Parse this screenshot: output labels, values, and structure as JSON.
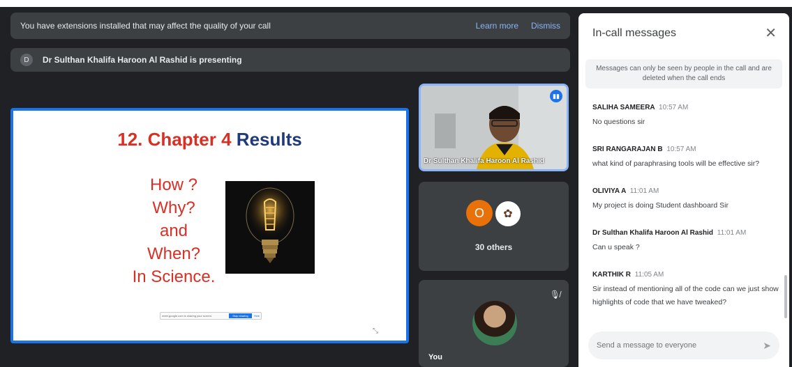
{
  "banner": {
    "message": "You have extensions installed that may affect the quality of your call",
    "learn_more": "Learn more",
    "dismiss": "Dismiss"
  },
  "presenting": {
    "initial": "D",
    "text": "Dr Sulthan Khalifa Haroon Al Rashid is presenting"
  },
  "slide": {
    "title_part1": "12. Chapter 4",
    "title_part2": "Results",
    "questions": [
      "How ?",
      "Why?",
      "and",
      "When?",
      "In Science."
    ],
    "bar_text": "meet.google.com is sharing your screen.",
    "bar_button": "Stop sharing",
    "bar_hide": "Hide"
  },
  "tiles": {
    "presenter_name": "Dr Sulthan Khalifa Haroon Al Rashid",
    "others_initial": "O",
    "others_label": "30 others",
    "you_label": "You"
  },
  "chat": {
    "title": "In-call messages",
    "note": "Messages can only be seen by people in the call and are deleted when the call ends",
    "messages": [
      {
        "sender": "SALIHA SAMEERA",
        "time": "10:57 AM",
        "text": "No questions sir"
      },
      {
        "sender": "SRI RANGARAJAN B",
        "time": "10:57 AM",
        "text": "what kind of paraphrasing tools will be effective sir?"
      },
      {
        "sender": "OLIVIYA A",
        "time": "11:01 AM",
        "text": "My project is doing Student dashboard Sir"
      },
      {
        "sender": "Dr Sulthan Khalifa Haroon Al Rashid",
        "time": "11:01 AM",
        "text": "Can u speak ?"
      },
      {
        "sender": "KARTHIK R",
        "time": "11:05 AM",
        "text": "Sir instead of mentioning all of the code can we just show highlights of code that we have tweaked?"
      }
    ],
    "input_placeholder": "Send a message to everyone"
  },
  "colors": {
    "background": "#202124",
    "accent": "#1a73e8",
    "link": "#8ab4f8",
    "slide_red": "#d93025",
    "slide_blue": "#1f3a7a"
  }
}
